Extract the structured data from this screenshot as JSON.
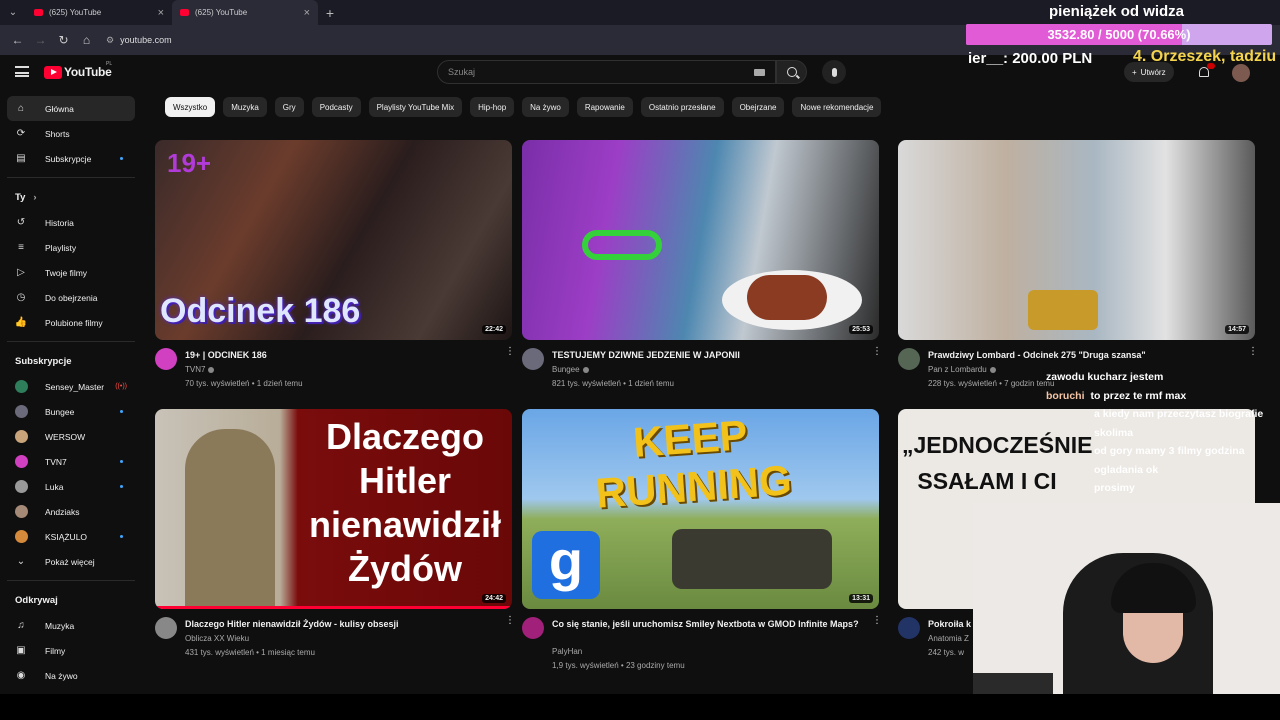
{
  "browser": {
    "tabs": [
      {
        "title": "(625) YouTube",
        "active": false
      },
      {
        "title": "(625) YouTube",
        "active": true
      }
    ],
    "url": "youtube.com"
  },
  "header": {
    "logo_text": "YouTube",
    "country": "PL",
    "search_placeholder": "Szukaj",
    "create_label": "Utwórz"
  },
  "sidebar": {
    "main": [
      {
        "label": "Główna",
        "icon": "home-icon",
        "active": true
      },
      {
        "label": "Shorts",
        "icon": "shorts-icon"
      },
      {
        "label": "Subskrypcje",
        "icon": "subscriptions-icon",
        "dot": true
      }
    ],
    "you_heading": "Ty",
    "you_chevron": "›",
    "you": [
      {
        "label": "Historia",
        "icon": "history-icon"
      },
      {
        "label": "Playlisty",
        "icon": "playlists-icon"
      },
      {
        "label": "Twoje filmy",
        "icon": "your-videos-icon"
      },
      {
        "label": "Do obejrzenia",
        "icon": "watch-later-icon"
      },
      {
        "label": "Polubione filmy",
        "icon": "liked-icon"
      }
    ],
    "subs_heading": "Subskrypcje",
    "subs": [
      {
        "label": "Sensey_Master",
        "color": "#2e7d5b",
        "live": true
      },
      {
        "label": "Bungee",
        "color": "#6a6a7a",
        "dot": true
      },
      {
        "label": "WERSOW",
        "color": "#c9a37a"
      },
      {
        "label": "TVN7",
        "color": "#d040c0",
        "dot": true
      },
      {
        "label": "Luka",
        "color": "#999999",
        "dot": true
      },
      {
        "label": "Andziaks",
        "color": "#a58a78"
      },
      {
        "label": "KSIĄŻULO",
        "color": "#d48a3a",
        "dot": true
      }
    ],
    "show_more": "Pokaż więcej",
    "explore_heading": "Odkrywaj",
    "explore": [
      {
        "label": "Muzyka",
        "icon": "music-icon"
      },
      {
        "label": "Filmy",
        "icon": "movies-icon"
      },
      {
        "label": "Na żywo",
        "icon": "live-icon"
      }
    ]
  },
  "chips": [
    "Wszystko",
    "Muzyka",
    "Gry",
    "Podcasty",
    "Playlisty YouTube Mix",
    "Hip-hop",
    "Na żywo",
    "Rapowanie",
    "Ostatnio przesłane",
    "Obejrzane",
    "Nowe rekomendacje"
  ],
  "videos": [
    {
      "title": "19+ | ODCINEK 186",
      "channel": "TVN7",
      "stats": "70 tys. wyświetleń • 1 dzień temu",
      "duration": "22:42",
      "thumb_text": "Odcinek 186",
      "avatar_color": "#d040c0"
    },
    {
      "title": "TESTUJEMY DZIWNE JEDZENIE W JAPONII",
      "channel": "Bungee",
      "stats": "821 tys. wyświetleń • 1 dzień temu",
      "duration": "25:53",
      "avatar_color": "#6a6a7a"
    },
    {
      "title": "Prawdziwy Lombard - Odcinek 275 \"Druga szansa\"",
      "channel": "Pan z Lombardu",
      "stats": "228 tys. wyświetleń • 7 godzin temu",
      "duration": "14:57",
      "avatar_color": "#556655"
    },
    {
      "title": "Dlaczego Hitler nienawidził Żydów - kulisy obsesji",
      "channel": "Oblicza XX Wieku",
      "stats": "431 tys. wyświetleń • 1 miesiąc temu",
      "duration": "24:42",
      "thumb_text": "Dlaczego Hitler nienawidził Żydów",
      "avatar_color": "#888888"
    },
    {
      "title": "Co się stanie, jeśli uruchomisz Smiley Nextbota w GMOD Infinite Maps?",
      "channel": "PalyHan",
      "stats": "1,9 tys. wyświetleń • 23 godziny temu",
      "duration": "13:31",
      "thumb_text": "KEEP RUNNING",
      "thumb_letter": "g",
      "avatar_color": "#a0207a"
    },
    {
      "title": "Pokroiła k",
      "channel": "Anatomia Z",
      "stats": "242 tys. w",
      "thumb_text": "„JEDNOCZEŚNIE SSAŁAM I CI",
      "avatar_color": "#223366"
    }
  ],
  "overlay": {
    "donation_title": "pieniążek od widza",
    "donation_progress": "3532.80 / 5000 (70.66%)",
    "donation_fraction": 0.7066,
    "donor_line": "ier__: 200.00 PLN",
    "rank_line": "4. Orzeszek, tadziu",
    "chat": [
      {
        "user": "",
        "msg": "zawodu kucharz jestem"
      },
      {
        "user": "boruchi",
        "msg": "to przez te rmf max"
      },
      {
        "user": "",
        "msg": "a kiedy nam przeczytasz biografie"
      },
      {
        "user": "",
        "msg": "skolima"
      },
      {
        "user": "",
        "msg": "od gory mamy 3 filmy godzina"
      },
      {
        "user": "",
        "msg": "ogladania ok"
      },
      {
        "user": "",
        "msg": "prosimy"
      }
    ]
  }
}
